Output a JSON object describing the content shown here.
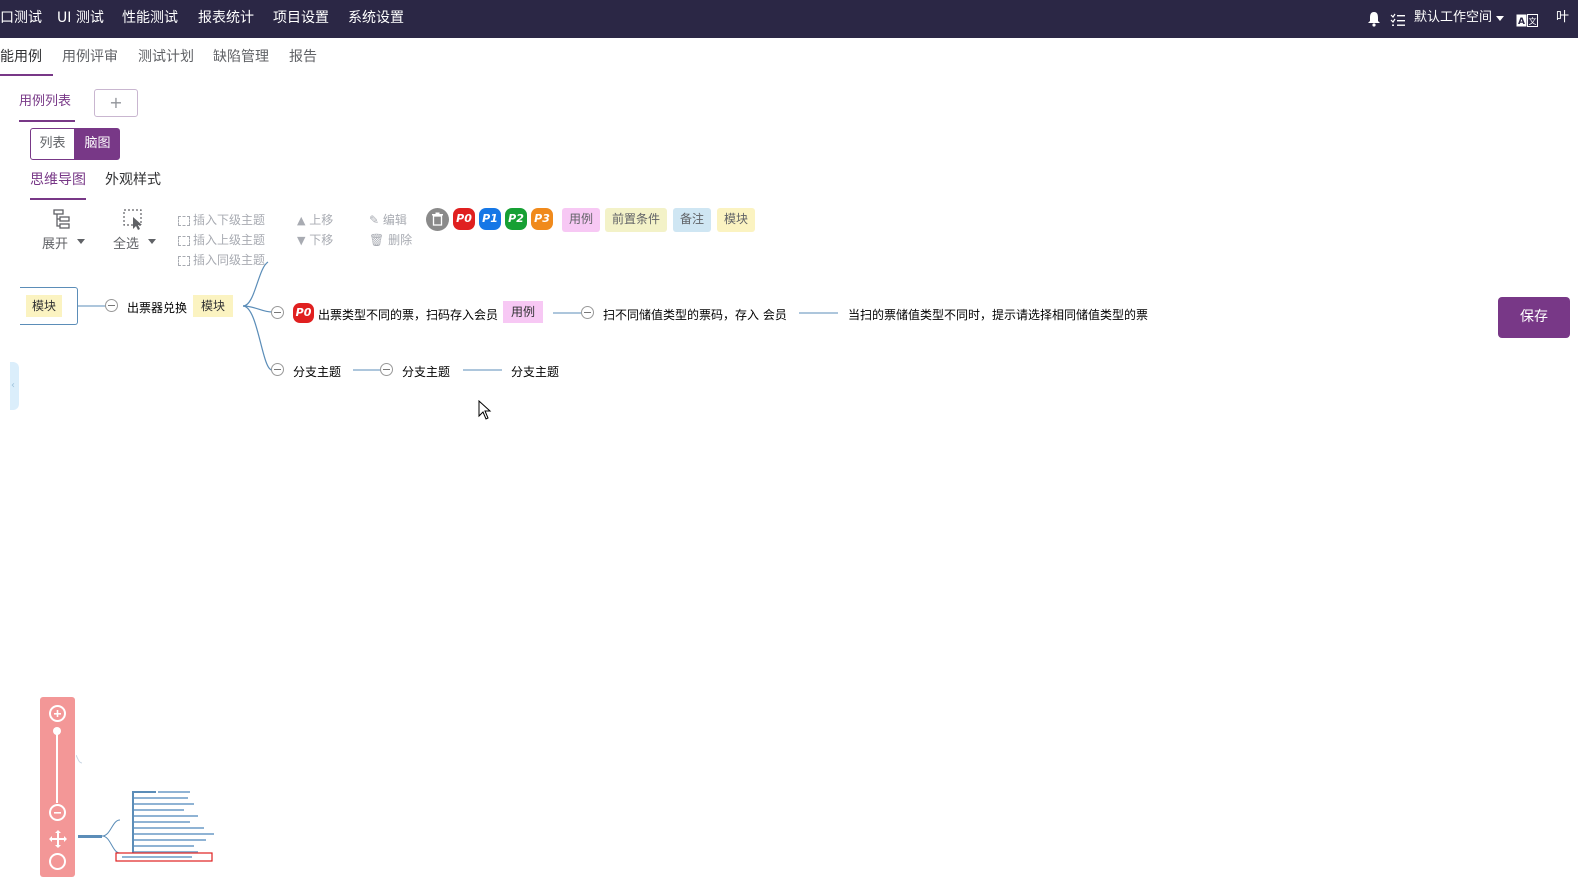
{
  "topbar": {
    "nav": [
      "口测试",
      "UI 测试",
      "性能测试",
      "报表统计",
      "项目设置",
      "系统设置"
    ],
    "workspace": "默认工作空间",
    "user": "叶"
  },
  "subnav": {
    "items": [
      "能用例",
      "用例评审",
      "测试计划",
      "缺陷管理",
      "报告"
    ]
  },
  "tabs": {
    "active": "用例列表",
    "add": "+"
  },
  "view_toggle": {
    "list": "列表",
    "mindmap": "脑图"
  },
  "subtabs": {
    "mindmap": "思维导图",
    "style": "外观样式"
  },
  "toolbar": {
    "expand": "展开",
    "select_all": "全选",
    "insert_child": "插入下级主题",
    "insert_parent": "插入上级主题",
    "insert_sibling": "插入同级主题",
    "move_up": "上移",
    "move_down": "下移",
    "edit": "编辑",
    "delete": "删除",
    "priorities": [
      "P0",
      "P1",
      "P2",
      "P3"
    ],
    "tags": [
      "用例",
      "前置条件",
      "备注",
      "模块"
    ]
  },
  "mindmap": {
    "root_tag": "模块",
    "node1": "出票器兑换",
    "node1_tag": "模块",
    "node2_priority": "P0",
    "node2": "出票类型不同的票，扫码存入会员",
    "node2_tag": "用例",
    "node3": "扫不同储值类型的票码，存入 会员",
    "node4": "当扫的票储值类型不同时，提示请选择相同储值类型的票",
    "branch1": "分支主题",
    "branch2": "分支主题",
    "branch3": "分支主题"
  },
  "save_label": "保存",
  "colors": {
    "brand": "#783887",
    "topbar": "#2b2745",
    "p0": "#e02020",
    "p1": "#1677e6",
    "p2": "#16a034",
    "p3": "#f08a1c"
  }
}
